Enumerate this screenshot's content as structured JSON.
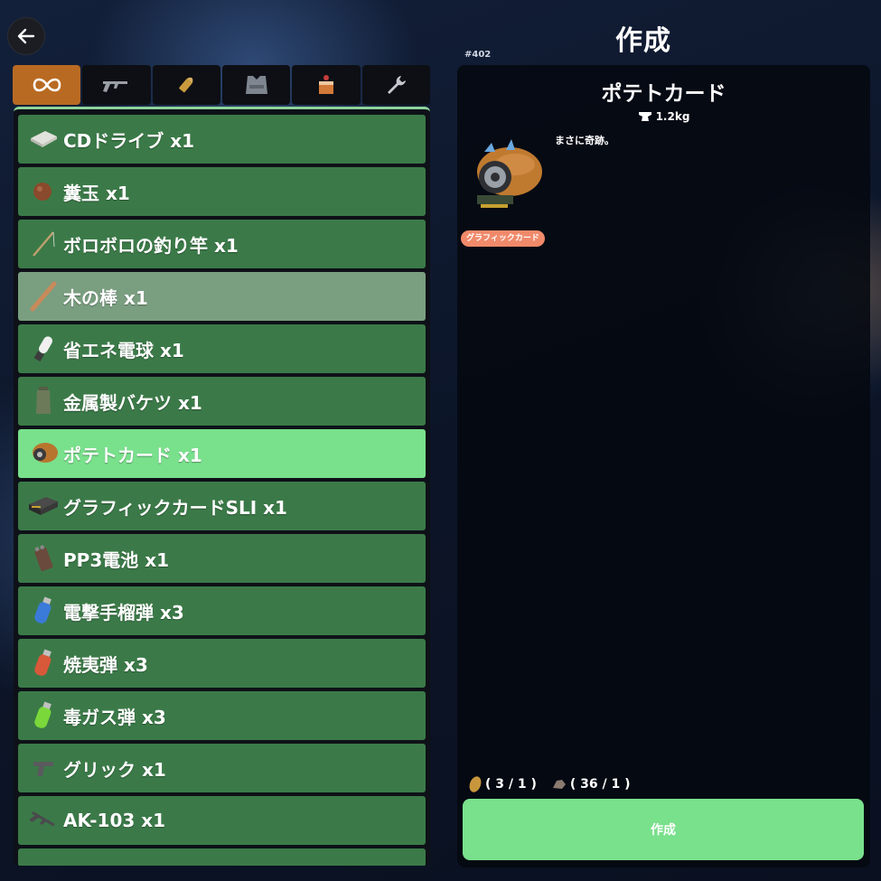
{
  "header": {
    "title": "作成",
    "id_label": "#402",
    "back_icon": "arrow-left-icon"
  },
  "tabs": [
    {
      "name": "all",
      "icon": "infinity-icon",
      "active": true
    },
    {
      "name": "weapons",
      "icon": "rifle-icon",
      "active": false
    },
    {
      "name": "ammo",
      "icon": "bullet-icon",
      "active": false
    },
    {
      "name": "armor",
      "icon": "vest-icon",
      "active": false
    },
    {
      "name": "food",
      "icon": "cake-icon",
      "active": false
    },
    {
      "name": "tools",
      "icon": "wrench-icon",
      "active": false
    }
  ],
  "items": [
    {
      "label": "CDドライブ x1",
      "icon": "cd-drive-icon",
      "state": "normal"
    },
    {
      "label": "糞玉 x1",
      "icon": "ball-icon",
      "state": "normal"
    },
    {
      "label": "ボロボロの釣り竿 x1",
      "icon": "fishing-rod-icon",
      "state": "normal"
    },
    {
      "label": "木の棒 x1",
      "icon": "stick-icon",
      "state": "highlight"
    },
    {
      "label": "省エネ電球 x1",
      "icon": "bulb-icon",
      "state": "normal"
    },
    {
      "label": "金属製バケツ x1",
      "icon": "bucket-icon",
      "state": "normal"
    },
    {
      "label": "ポテトカード x1",
      "icon": "graphics-card-icon",
      "state": "selected"
    },
    {
      "label": "グラフィックカードSLI x1",
      "icon": "gpu-sli-icon",
      "state": "normal"
    },
    {
      "label": "PP3電池 x1",
      "icon": "battery-icon",
      "state": "normal"
    },
    {
      "label": "電撃手榴弾 x3",
      "icon": "shock-grenade-icon",
      "state": "normal"
    },
    {
      "label": "焼夷弾 x3",
      "icon": "incendiary-grenade-icon",
      "state": "normal"
    },
    {
      "label": "毒ガス弾 x3",
      "icon": "gas-grenade-icon",
      "state": "normal"
    },
    {
      "label": "グリック x1",
      "icon": "pistol-icon",
      "state": "normal"
    },
    {
      "label": "AK-103 x1",
      "icon": "rifle-icon",
      "state": "normal"
    }
  ],
  "detail": {
    "title": "ポテトカード",
    "weight": "1.2kg",
    "description": "まさに奇跡。",
    "tag": "グラフィックカード",
    "requirements": [
      {
        "icon": "potato-icon",
        "text": "( 3 / 1 )"
      },
      {
        "icon": "scrap-icon",
        "text": "( 36 / 1 )"
      }
    ],
    "craft_label": "作成"
  },
  "colors": {
    "item_bg": "#3b7a48",
    "item_selected": "#79e08c",
    "item_highlight": "#7a9e80",
    "tab_active": "#b86a22",
    "tag": "#f08a6a"
  }
}
